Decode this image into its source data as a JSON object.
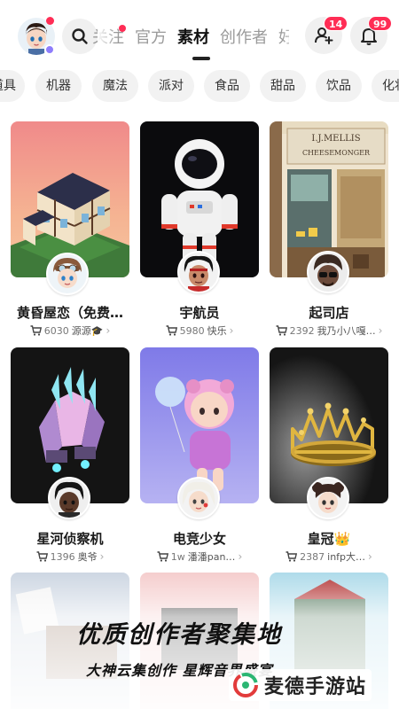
{
  "header": {
    "tabs": [
      {
        "label": "关注"
      },
      {
        "label": "官方"
      },
      {
        "label": "素材",
        "active": true
      },
      {
        "label": "创作者"
      },
      {
        "label": "好友"
      }
    ],
    "invite_badge": "14",
    "notification_badge": "99"
  },
  "categories": [
    "道具",
    "机器",
    "魔法",
    "派对",
    "食品",
    "甜品",
    "饮品",
    "化妆"
  ],
  "cards": [
    {
      "title": "黄昏屋恋（免费…",
      "count": "6030",
      "creator": "源源🎓"
    },
    {
      "title": "宇航员",
      "count": "5980",
      "creator": "快乐"
    },
    {
      "title": "起司店",
      "count": "2392",
      "creator": "我乃小八嘎…"
    },
    {
      "title": "星河侦察机",
      "count": "1396",
      "creator": "奥爷"
    },
    {
      "title": "电竞少女",
      "count": "1w",
      "creator": "潘潘pan…"
    },
    {
      "title": "皇冠👑",
      "count": "2387",
      "creator": "infp大…"
    }
  ],
  "shop_sign": {
    "line1": "I.J.MELLIS",
    "line2": "CHEESEMONGER"
  },
  "promo": {
    "title": "优质创作者聚集地",
    "subtitle": "大神云集创作  星辉音界盛宴",
    "brand": "麦德手游站"
  },
  "colors": {
    "accent": "#ff2d55",
    "chip_bg": "#f2f2f2"
  },
  "icons": [
    "search-icon",
    "add-user-icon",
    "bell-icon",
    "cart-icon",
    "chevron-right-icon"
  ]
}
